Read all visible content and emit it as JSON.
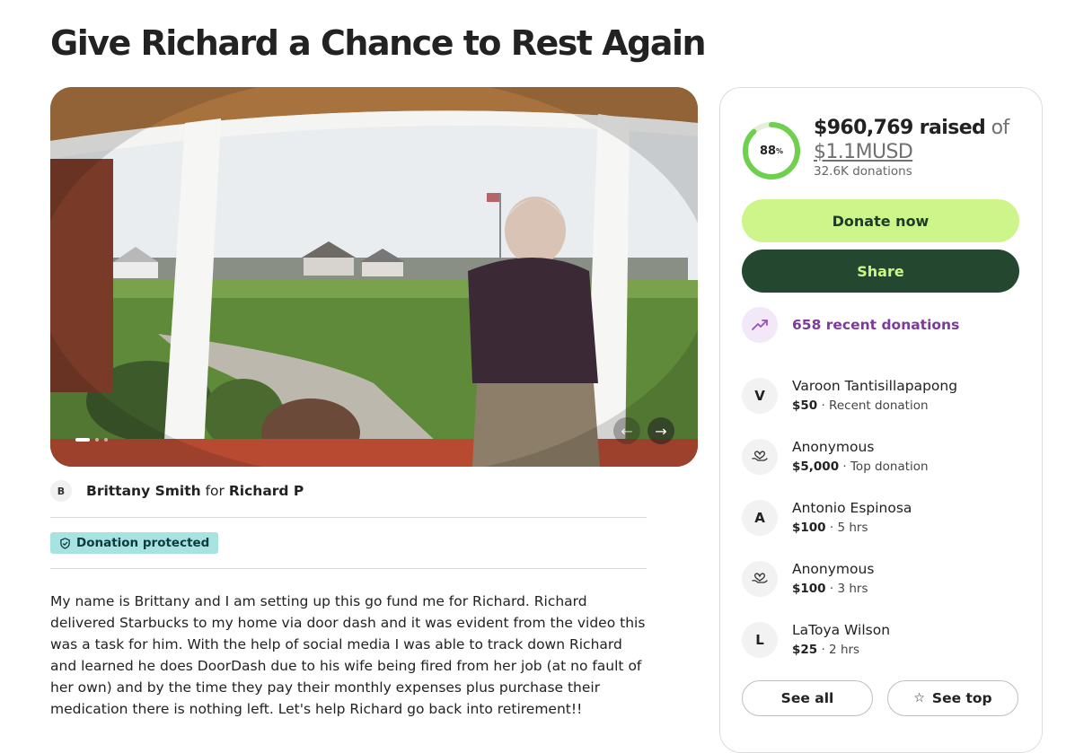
{
  "title": "Give Richard a Chance to Rest Again",
  "organizer": {
    "avatar_initial": "B",
    "name": "Brittany Smith",
    "connector": "for",
    "beneficiary": "Richard P"
  },
  "badge": {
    "label": "Donation protected",
    "icon": "shield-check-icon"
  },
  "story": "My name is Brittany and I am setting up this go fund me for Richard. Richard delivered Starbucks to my home via door dash and it was evident from the video this was a task for him. With the help of social media I was able to track down Richard and learned he does DoorDash due to his wife being fired from her job (at no fault of her own) and by the time they pay their monthly expenses plus purchase their medication there is nothing left. Let's help Richard go back into retirement!!",
  "carousel": {
    "current": 1,
    "total": 3
  },
  "fundraiser": {
    "progress_percent": 88,
    "progress_label": "88",
    "progress_suffix": "%",
    "raised": "$960,769 raised",
    "of": "of",
    "goal": "$1.1MUSD",
    "donation_count": "32.6K donations",
    "donate_label": "Donate now",
    "share_label": "Share",
    "recent_label": "658 recent donations",
    "see_all_label": "See all",
    "see_top_label": "See top"
  },
  "donors": [
    {
      "avatar": "V",
      "name": "Varoon Tantisillapapong",
      "amount": "$50",
      "detail": " · Recent donation"
    },
    {
      "avatar": "",
      "icon": "heart-hand-icon",
      "name": "Anonymous",
      "amount": "$5,000",
      "detail": " · Top donation"
    },
    {
      "avatar": "A",
      "name": "Antonio Espinosa",
      "amount": "$100",
      "detail": " · 5 hrs"
    },
    {
      "avatar": "",
      "icon": "heart-hand-icon",
      "name": "Anonymous",
      "amount": "$100",
      "detail": " · 3 hrs"
    },
    {
      "avatar": "L",
      "name": "LaToya Wilson",
      "amount": "$25",
      "detail": " · 2 hrs"
    }
  ],
  "colors": {
    "donate_bg": "#cdf58a",
    "share_bg": "#24482f",
    "progress": "#6fcf4f",
    "recent_purple": "#7c3b9b",
    "badge_bg": "#a7e3e1"
  }
}
